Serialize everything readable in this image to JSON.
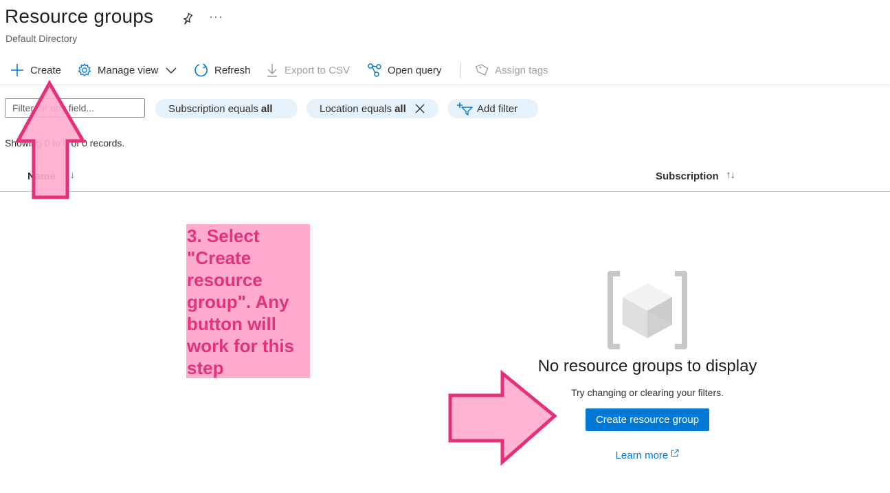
{
  "page": {
    "title": "Resource groups",
    "subtitle": "Default Directory",
    "more_glyph": "···"
  },
  "toolbar": {
    "create": "Create",
    "manage_view": "Manage view",
    "refresh": "Refresh",
    "export_csv": "Export to CSV",
    "open_query": "Open query",
    "assign_tags": "Assign tags"
  },
  "filters": {
    "search_placeholder": "Filter for any field...",
    "subscription_label": "Subscription equals",
    "subscription_value": "all",
    "location_label": "Location equals",
    "location_value": "all",
    "add_filter": "Add filter"
  },
  "records": {
    "showing": "Showing 0 to 0 of 0 records."
  },
  "table": {
    "columns": [
      {
        "label": "Name",
        "sort_glyph": "↑↓"
      },
      {
        "label": "Subscription",
        "sort_glyph": "↑↓"
      }
    ]
  },
  "empty_state": {
    "title": "No resource groups to display",
    "hint": "Try changing or clearing your filters.",
    "create_button": "Create resource group",
    "learn_more": "Learn more"
  },
  "annotation": {
    "instruction": "3. Select \"Create resource group\". Any button will work for this step"
  },
  "colors": {
    "accent": "#0078d4",
    "pill_bg": "#e5f1fb",
    "annotation_fill": "#ffaccc",
    "annotation_stroke": "#e4317b"
  },
  "icons": [
    "pin-icon",
    "plus-icon",
    "gear-icon",
    "chevron-down-icon",
    "refresh-icon",
    "download-icon",
    "query-icon",
    "tag-icon",
    "close-icon",
    "add-filter-icon",
    "resource-group-icon",
    "external-link-icon"
  ]
}
